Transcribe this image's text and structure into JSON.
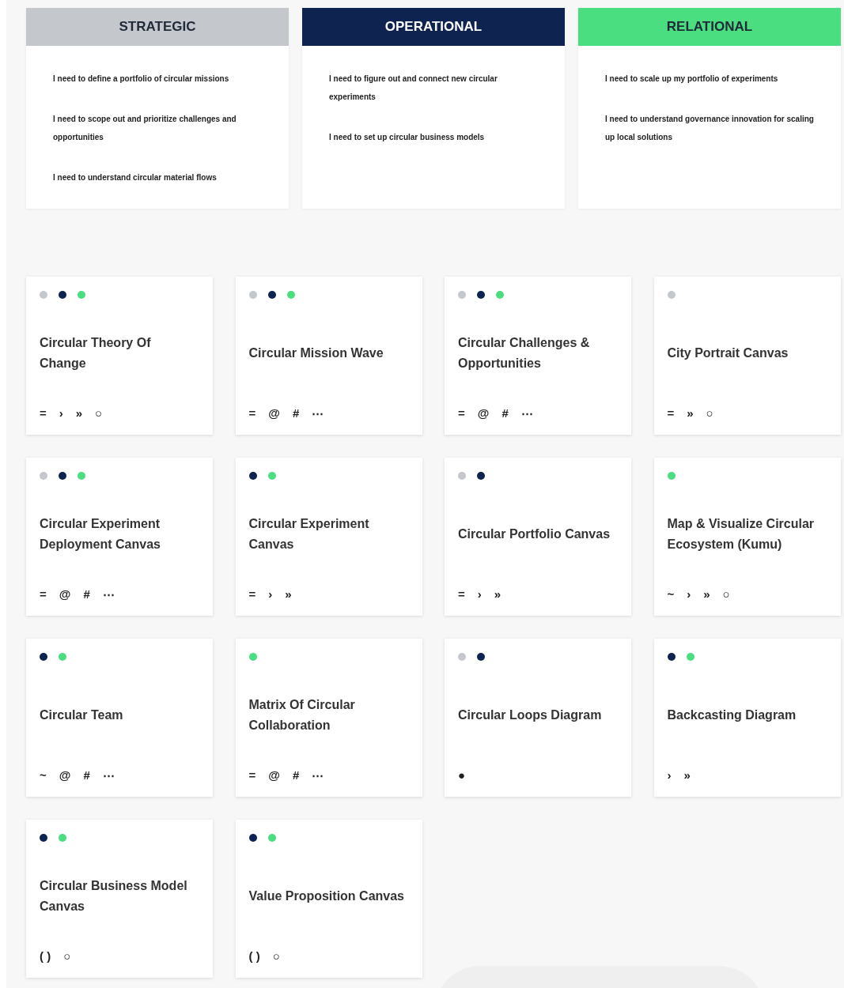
{
  "columns": [
    {
      "label": "STRATEGIC",
      "color": "#c4c7cc",
      "kind": "dark",
      "statements": [
        "I need to define a portfolio of circular missions",
        "I need to scope out and prioritize challenges and opportunities",
        "I need to understand circular material flows"
      ]
    },
    {
      "label": "OPERATIONAL",
      "color": "#0f2350",
      "kind": "light",
      "statements": [
        "I need to figure out and connect new circular experiments",
        "I need to set up circular business models"
      ]
    },
    {
      "label": "RELATIONAL",
      "color": "#4ade80",
      "kind": "dark",
      "statements": [
        "I need to scale up my portfolio of experiments",
        "I need to understand governance innovation for scaling up local solutions"
      ]
    }
  ],
  "tools": [
    {
      "title": "Circular Theory Of Change",
      "dots": [
        {
          "color": "#c4c7cc"
        },
        {
          "color": "#0f2350"
        },
        {
          "color": "#4ade80"
        }
      ],
      "symbols": [
        "=",
        "›",
        "»",
        "○"
      ]
    },
    {
      "title": "Circular Mission Wave",
      "dots": [
        {
          "color": "#c4c7cc"
        },
        {
          "color": "#0f2350"
        },
        {
          "color": "#4ade80"
        }
      ],
      "symbols": [
        "=",
        "@",
        "#",
        "⋯"
      ]
    },
    {
      "title": "Circular Challenges & Opportunities",
      "dots": [
        {
          "color": "#c4c7cc"
        },
        {
          "color": "#0f2350"
        },
        {
          "color": "#4ade80"
        }
      ],
      "symbols": [
        "=",
        "@",
        "#",
        "⋯"
      ]
    },
    {
      "title": "City Portrait Canvas",
      "dots": [
        {
          "color": "#c4c7cc"
        }
      ],
      "symbols": [
        "=",
        "»",
        "○"
      ]
    },
    {
      "title": "Circular Experiment Deployment Canvas",
      "dots": [
        {
          "color": "#c4c7cc"
        },
        {
          "color": "#0f2350"
        },
        {
          "color": "#4ade80"
        }
      ],
      "symbols": [
        "=",
        "@",
        "#",
        "⋯"
      ]
    },
    {
      "title": "Circular Experiment Canvas",
      "dots": [
        {
          "color": "#0f2350"
        },
        {
          "color": "#4ade80"
        }
      ],
      "symbols": [
        "=",
        "›",
        "»"
      ]
    },
    {
      "title": "Circular Portfolio Canvas",
      "dots": [
        {
          "color": "#c4c7cc"
        },
        {
          "color": "#0f2350"
        }
      ],
      "symbols": [
        "=",
        "›",
        "»"
      ]
    },
    {
      "title": "Map & Visualize Circular Ecosystem (Kumu)",
      "dots": [
        {
          "color": "#4ade80"
        }
      ],
      "symbols": [
        "~",
        "›",
        "»",
        "○"
      ]
    },
    {
      "title": "Circular Team",
      "dots": [
        {
          "color": "#0f2350"
        },
        {
          "color": "#4ade80"
        }
      ],
      "symbols": [
        "~",
        "@",
        "#",
        "⋯"
      ]
    },
    {
      "title": "Matrix Of Circular Collaboration",
      "dots": [
        {
          "color": "#4ade80"
        }
      ],
      "symbols": [
        "=",
        "@",
        "#",
        "⋯"
      ]
    },
    {
      "title": "Circular Loops Diagram",
      "dots": [
        {
          "color": "#c4c7cc"
        },
        {
          "color": "#0f2350"
        }
      ],
      "symbols": [
        "●"
      ]
    },
    {
      "title": "Backcasting Diagram",
      "dots": [
        {
          "color": "#0f2350"
        },
        {
          "color": "#4ade80"
        }
      ],
      "symbols": [
        "›",
        "»"
      ]
    },
    {
      "title": "Circular Business Model Canvas",
      "dots": [
        {
          "color": "#0f2350"
        },
        {
          "color": "#4ade80"
        }
      ],
      "symbols": [
        "( )",
        "○"
      ]
    },
    {
      "title": "Value Proposition Canvas",
      "dots": [
        {
          "color": "#0f2350"
        },
        {
          "color": "#4ade80"
        }
      ],
      "symbols": [
        "( )",
        "○"
      ]
    }
  ]
}
